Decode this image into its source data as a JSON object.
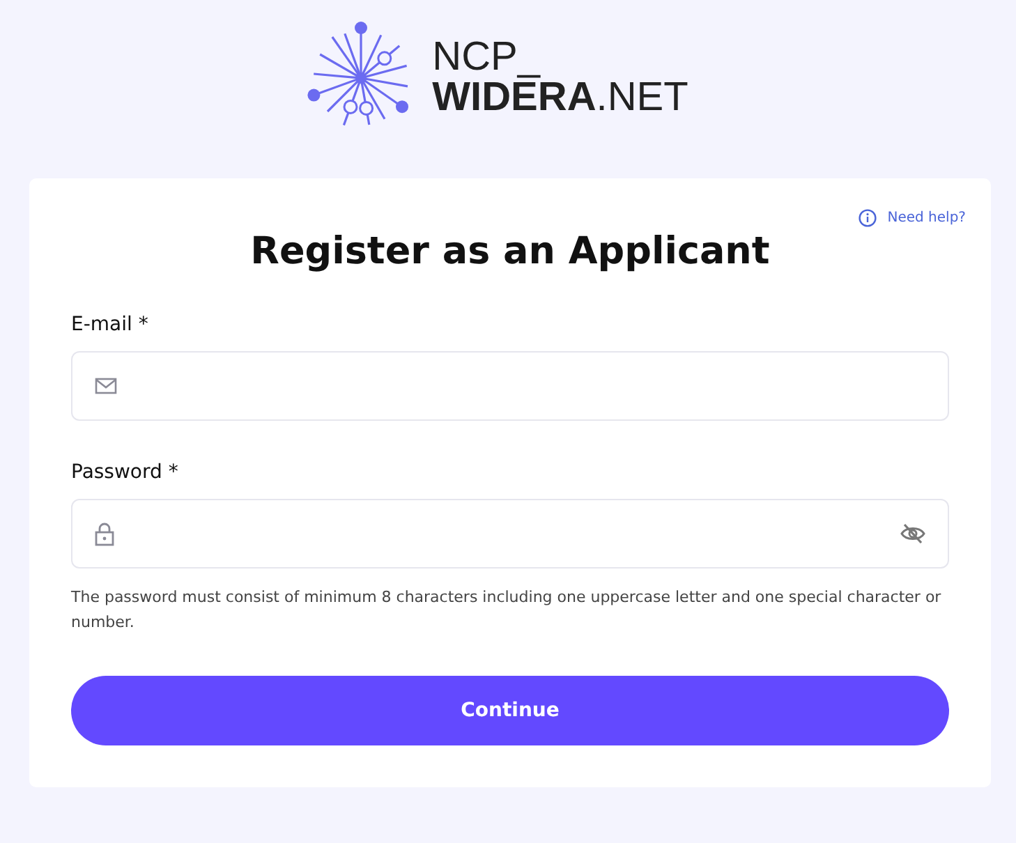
{
  "logo": {
    "line_1": "NCP_",
    "line_2": "**WIDERA**.NET"
  },
  "help_link": "Need help?",
  "title": "Register as an Applicant",
  "fields": [
    {
      "kind": "email",
      "label": "E-mail *"
    },
    {
      "kind": "password",
      "label": "Password *"
    }
  ],
  "hint": "The password must consist of minimum 8 characters including one uppercase letter and one special character or number.",
  "button": "Continue"
}
